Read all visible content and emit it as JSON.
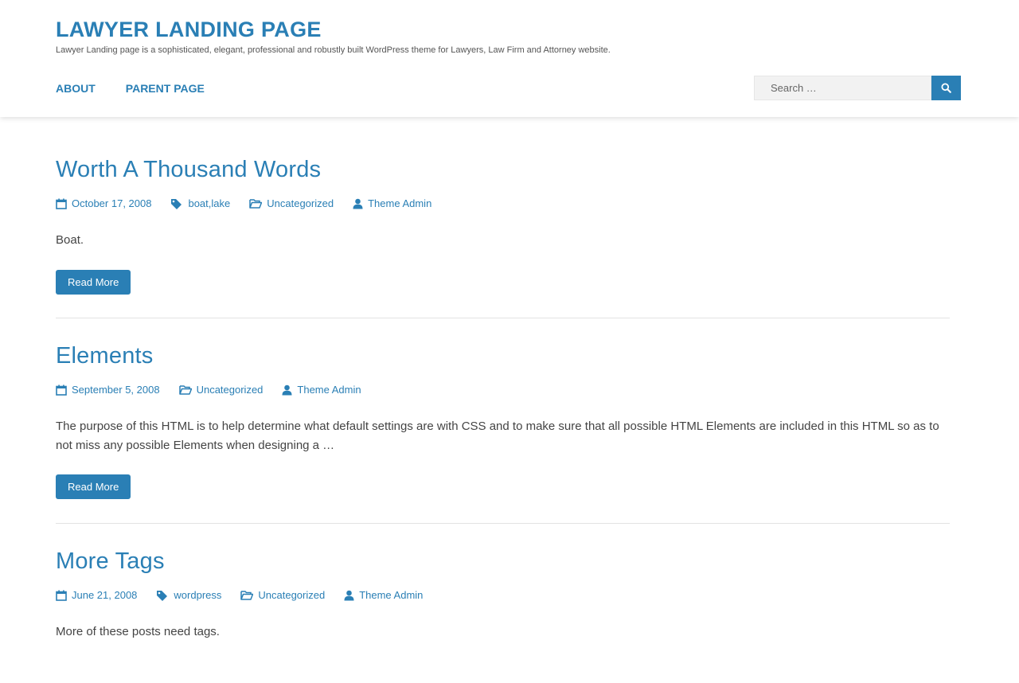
{
  "site": {
    "title": "LAWYER LANDING PAGE",
    "tagline": "Lawyer Landing page is a sophisticated, elegant, professional and robustly built WordPress theme for Lawyers, Law Firm and Attorney website."
  },
  "nav": {
    "items": [
      {
        "label": "ABOUT"
      },
      {
        "label": "PARENT PAGE"
      }
    ]
  },
  "search": {
    "placeholder": "Search …",
    "icon": "search-icon"
  },
  "colors": {
    "accent": "#2a7fb5",
    "text": "#444444",
    "search_bg": "#f2f2f2"
  },
  "posts": [
    {
      "title": "Worth A Thousand Words",
      "date": "October 17, 2008",
      "tags": [
        "boat",
        "lake"
      ],
      "tag_sep": ", ",
      "category": "Uncategorized",
      "author": "Theme Admin",
      "excerpt": "Boat.",
      "read_more": "Read More"
    },
    {
      "title": "Elements",
      "date": "September 5, 2008",
      "category": "Uncategorized",
      "author": "Theme Admin",
      "excerpt": "The purpose of this HTML is to help determine what default settings are with CSS and to make sure that all possible HTML Elements are included in this HTML so as to not miss any possible Elements when designing a …",
      "read_more": "Read More"
    },
    {
      "title": "More Tags",
      "date": "June 21, 2008",
      "tags": [
        "wordpress"
      ],
      "category": "Uncategorized",
      "author": "Theme Admin",
      "excerpt": "More of these posts need tags."
    }
  ]
}
